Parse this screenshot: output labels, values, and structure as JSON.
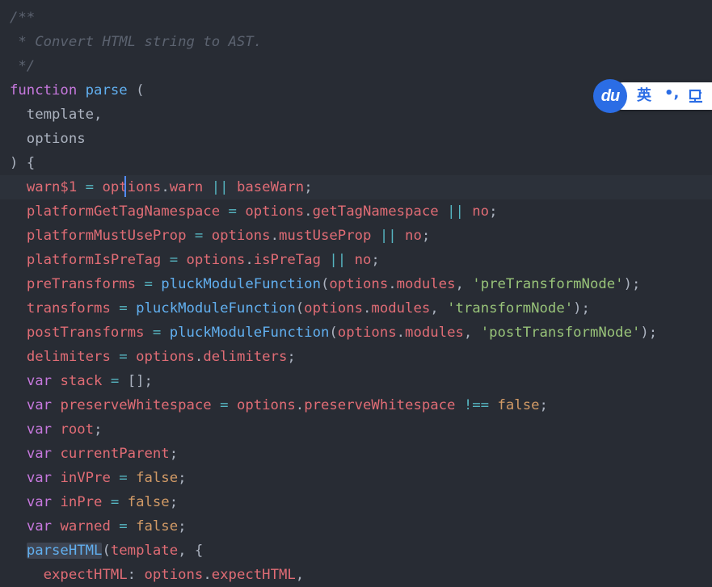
{
  "editor": {
    "theme_colors": {
      "background": "#282c34",
      "comment": "#5c6370",
      "keyword": "#c678dd",
      "function": "#61afef",
      "variable": "#e06c75",
      "operator": "#56b6c2",
      "string": "#98c379",
      "boolean": "#d19a66",
      "plain": "#abb2bf",
      "cursor": "#528bff"
    },
    "lines": [
      [
        [
          "comment",
          "/**"
        ]
      ],
      [
        [
          "comment",
          " * Convert HTML string to AST."
        ]
      ],
      [
        [
          "comment",
          " */"
        ]
      ],
      [
        [
          "keyword",
          "function"
        ],
        [
          "plain",
          " "
        ],
        [
          "func",
          "parse"
        ],
        [
          "plain",
          " ("
        ]
      ],
      [
        [
          "plain",
          "  template,"
        ]
      ],
      [
        [
          "plain",
          "  options"
        ]
      ],
      [
        [
          "plain",
          ") {"
        ]
      ],
      [
        [
          "plain",
          "  "
        ],
        [
          "var",
          "warn$1"
        ],
        [
          "plain",
          " "
        ],
        [
          "op",
          "="
        ],
        [
          "plain",
          " "
        ],
        [
          "var",
          "options"
        ],
        [
          "punct",
          "."
        ],
        [
          "var",
          "warn"
        ],
        [
          "plain",
          " "
        ],
        [
          "op",
          "||"
        ],
        [
          "plain",
          " "
        ],
        [
          "var",
          "baseWarn"
        ],
        [
          "punct",
          ";"
        ]
      ],
      [
        [
          "plain",
          "  "
        ],
        [
          "var",
          "platformGetTagNamespace"
        ],
        [
          "plain",
          " "
        ],
        [
          "op",
          "="
        ],
        [
          "plain",
          " "
        ],
        [
          "var",
          "options"
        ],
        [
          "punct",
          "."
        ],
        [
          "var",
          "getTagNamespace"
        ],
        [
          "plain",
          " "
        ],
        [
          "op",
          "||"
        ],
        [
          "plain",
          " "
        ],
        [
          "var",
          "no"
        ],
        [
          "punct",
          ";"
        ]
      ],
      [
        [
          "plain",
          "  "
        ],
        [
          "var",
          "platformMustUseProp"
        ],
        [
          "plain",
          " "
        ],
        [
          "op",
          "="
        ],
        [
          "plain",
          " "
        ],
        [
          "var",
          "options"
        ],
        [
          "punct",
          "."
        ],
        [
          "var",
          "mustUseProp"
        ],
        [
          "plain",
          " "
        ],
        [
          "op",
          "||"
        ],
        [
          "plain",
          " "
        ],
        [
          "var",
          "no"
        ],
        [
          "punct",
          ";"
        ]
      ],
      [
        [
          "plain",
          "  "
        ],
        [
          "var",
          "platformIsPreTag"
        ],
        [
          "plain",
          " "
        ],
        [
          "op",
          "="
        ],
        [
          "plain",
          " "
        ],
        [
          "var",
          "options"
        ],
        [
          "punct",
          "."
        ],
        [
          "var",
          "isPreTag"
        ],
        [
          "plain",
          " "
        ],
        [
          "op",
          "||"
        ],
        [
          "plain",
          " "
        ],
        [
          "var",
          "no"
        ],
        [
          "punct",
          ";"
        ]
      ],
      [
        [
          "plain",
          "  "
        ],
        [
          "var",
          "preTransforms"
        ],
        [
          "plain",
          " "
        ],
        [
          "op",
          "="
        ],
        [
          "plain",
          " "
        ],
        [
          "func",
          "pluckModuleFunction"
        ],
        [
          "punct",
          "("
        ],
        [
          "var",
          "options"
        ],
        [
          "punct",
          "."
        ],
        [
          "var",
          "modules"
        ],
        [
          "punct",
          ", "
        ],
        [
          "string",
          "'preTransformNode'"
        ],
        [
          "punct",
          ");"
        ]
      ],
      [
        [
          "plain",
          "  "
        ],
        [
          "var",
          "transforms"
        ],
        [
          "plain",
          " "
        ],
        [
          "op",
          "="
        ],
        [
          "plain",
          " "
        ],
        [
          "func",
          "pluckModuleFunction"
        ],
        [
          "punct",
          "("
        ],
        [
          "var",
          "options"
        ],
        [
          "punct",
          "."
        ],
        [
          "var",
          "modules"
        ],
        [
          "punct",
          ", "
        ],
        [
          "string",
          "'transformNode'"
        ],
        [
          "punct",
          ");"
        ]
      ],
      [
        [
          "plain",
          "  "
        ],
        [
          "var",
          "postTransforms"
        ],
        [
          "plain",
          " "
        ],
        [
          "op",
          "="
        ],
        [
          "plain",
          " "
        ],
        [
          "func",
          "pluckModuleFunction"
        ],
        [
          "punct",
          "("
        ],
        [
          "var",
          "options"
        ],
        [
          "punct",
          "."
        ],
        [
          "var",
          "modules"
        ],
        [
          "punct",
          ", "
        ],
        [
          "string",
          "'postTransformNode'"
        ],
        [
          "punct",
          ");"
        ]
      ],
      [
        [
          "plain",
          "  "
        ],
        [
          "var",
          "delimiters"
        ],
        [
          "plain",
          " "
        ],
        [
          "op",
          "="
        ],
        [
          "plain",
          " "
        ],
        [
          "var",
          "options"
        ],
        [
          "punct",
          "."
        ],
        [
          "var",
          "delimiters"
        ],
        [
          "punct",
          ";"
        ]
      ],
      [
        [
          "plain",
          "  "
        ],
        [
          "keyword",
          "var"
        ],
        [
          "plain",
          " "
        ],
        [
          "var",
          "stack"
        ],
        [
          "plain",
          " "
        ],
        [
          "op",
          "="
        ],
        [
          "plain",
          " "
        ],
        [
          "punct",
          "[];"
        ]
      ],
      [
        [
          "plain",
          "  "
        ],
        [
          "keyword",
          "var"
        ],
        [
          "plain",
          " "
        ],
        [
          "var",
          "preserveWhitespace"
        ],
        [
          "plain",
          " "
        ],
        [
          "op",
          "="
        ],
        [
          "plain",
          " "
        ],
        [
          "var",
          "options"
        ],
        [
          "punct",
          "."
        ],
        [
          "var",
          "preserveWhitespace"
        ],
        [
          "plain",
          " "
        ],
        [
          "op",
          "!=="
        ],
        [
          "plain",
          " "
        ],
        [
          "bool",
          "false"
        ],
        [
          "punct",
          ";"
        ]
      ],
      [
        [
          "plain",
          "  "
        ],
        [
          "keyword",
          "var"
        ],
        [
          "plain",
          " "
        ],
        [
          "var",
          "root"
        ],
        [
          "punct",
          ";"
        ]
      ],
      [
        [
          "plain",
          "  "
        ],
        [
          "keyword",
          "var"
        ],
        [
          "plain",
          " "
        ],
        [
          "var",
          "currentParent"
        ],
        [
          "punct",
          ";"
        ]
      ],
      [
        [
          "plain",
          "  "
        ],
        [
          "keyword",
          "var"
        ],
        [
          "plain",
          " "
        ],
        [
          "var",
          "inVPre"
        ],
        [
          "plain",
          " "
        ],
        [
          "op",
          "="
        ],
        [
          "plain",
          " "
        ],
        [
          "bool",
          "false"
        ],
        [
          "punct",
          ";"
        ]
      ],
      [
        [
          "plain",
          "  "
        ],
        [
          "keyword",
          "var"
        ],
        [
          "plain",
          " "
        ],
        [
          "var",
          "inPre"
        ],
        [
          "plain",
          " "
        ],
        [
          "op",
          "="
        ],
        [
          "plain",
          " "
        ],
        [
          "bool",
          "false"
        ],
        [
          "punct",
          ";"
        ]
      ],
      [
        [
          "plain",
          "  "
        ],
        [
          "keyword",
          "var"
        ],
        [
          "plain",
          " "
        ],
        [
          "var",
          "warned"
        ],
        [
          "plain",
          " "
        ],
        [
          "op",
          "="
        ],
        [
          "plain",
          " "
        ],
        [
          "bool",
          "false"
        ],
        [
          "punct",
          ";"
        ]
      ],
      [
        [
          "plain",
          "  "
        ],
        [
          "sel",
          "parseHTML"
        ],
        [
          "punct",
          "("
        ],
        [
          "var",
          "template"
        ],
        [
          "punct",
          ", {"
        ]
      ],
      [
        [
          "plain",
          "    "
        ],
        [
          "var",
          "expectHTML"
        ],
        [
          "punct",
          ": "
        ],
        [
          "var",
          "options"
        ],
        [
          "punct",
          "."
        ],
        [
          "var",
          "expectHTML"
        ],
        [
          "punct",
          ","
        ]
      ]
    ]
  },
  "ime_toolbar": {
    "logo_text": "du",
    "language_label": "英",
    "punctuation_label": "•,",
    "accent_color": "#2b6de5",
    "tool_icon": "cup-icon"
  }
}
